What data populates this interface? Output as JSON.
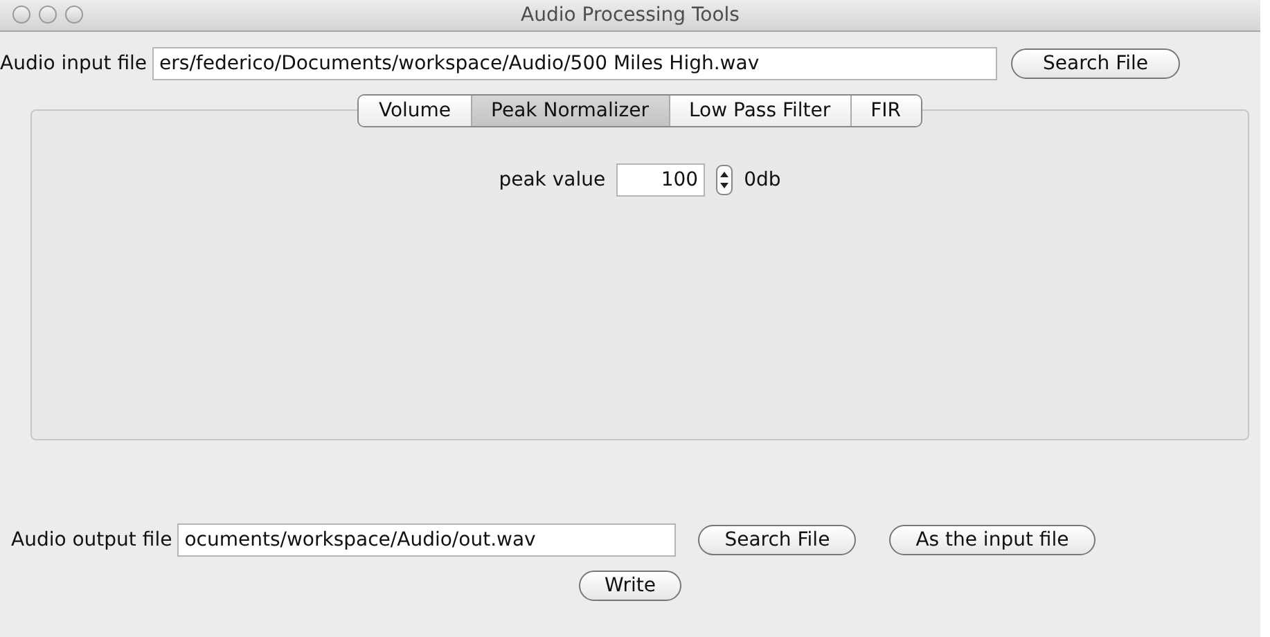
{
  "window": {
    "title": "Audio Processing Tools"
  },
  "input_file": {
    "label": "Audio input file",
    "value": "ers/federico/Documents/workspace/Audio/500 Miles High.wav",
    "button": "Search File"
  },
  "tabs": [
    {
      "label": "Volume",
      "selected": false
    },
    {
      "label": "Peak Normalizer",
      "selected": true
    },
    {
      "label": "Low Pass Filter",
      "selected": false
    },
    {
      "label": "FIR",
      "selected": false
    }
  ],
  "peak": {
    "label": "peak value",
    "value": "100",
    "unit": "0db"
  },
  "output_file": {
    "label": "Audio output file",
    "value": "ocuments/workspace/Audio/out.wav",
    "buttons": [
      "Search File",
      "As the input file"
    ]
  },
  "write_button": "Write"
}
